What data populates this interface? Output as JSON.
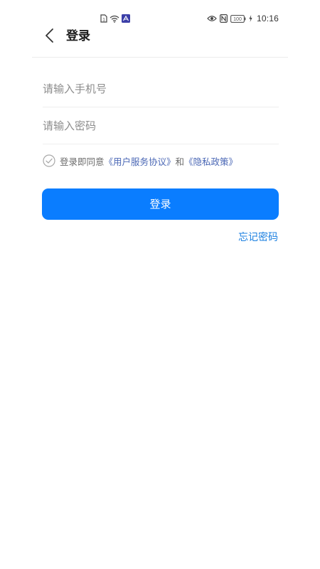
{
  "status_bar": {
    "time": "10:16",
    "battery": "100",
    "left_icons": [
      "sim-card-icon",
      "wifi-icon",
      "app-notification-icon"
    ],
    "right_icons": [
      "eye-icon",
      "nfc-icon",
      "battery-icon",
      "charging-icon"
    ]
  },
  "header": {
    "title": "登录",
    "back_icon": "chevron-left-icon"
  },
  "form": {
    "phone_placeholder": "请输入手机号",
    "phone_value": "",
    "password_placeholder": "请输入密码",
    "password_value": ""
  },
  "agreement": {
    "checked": false,
    "prefix": "登录即同意",
    "terms_link": "《用户服务协议》",
    "conjunction": "和",
    "privacy_link": "《隐私政策》"
  },
  "login_button": {
    "label": "登录"
  },
  "forgot_password": {
    "label": "忘记密码"
  },
  "colors": {
    "primary": "#0a7dff",
    "link": "#4a67b5",
    "forgot_link": "#1a7fe0",
    "placeholder": "#8d8d8d"
  }
}
